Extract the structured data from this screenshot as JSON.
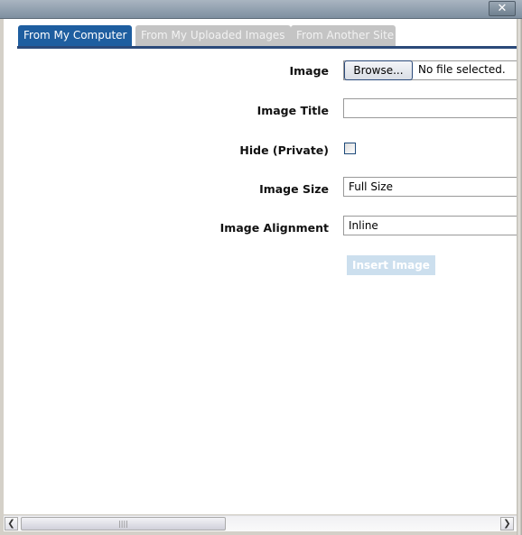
{
  "window": {
    "close_label": "✕"
  },
  "tabs": [
    {
      "label": "From My Computer",
      "active": true
    },
    {
      "label": "From My Uploaded Images",
      "active": false
    },
    {
      "label": "From Another Site",
      "active": false
    }
  ],
  "form": {
    "image_label": "Image",
    "browse_label": "Browse...",
    "file_status": "No file selected.",
    "title_label": "Image Title",
    "title_value": "",
    "hide_label": "Hide (Private)",
    "hide_checked": false,
    "size_label": "Image Size",
    "size_value": "Full Size",
    "align_label": "Image Alignment",
    "align_value": "Inline",
    "insert_label": "Insert Image"
  },
  "scrollbar": {
    "left_arrow": "❮",
    "right_arrow": "❯",
    "grip": "||||"
  },
  "colors": {
    "active_tab": "#1e5ea0",
    "inactive_tab": "#c4c4c4",
    "insert_disabled": "#ccdfee"
  }
}
